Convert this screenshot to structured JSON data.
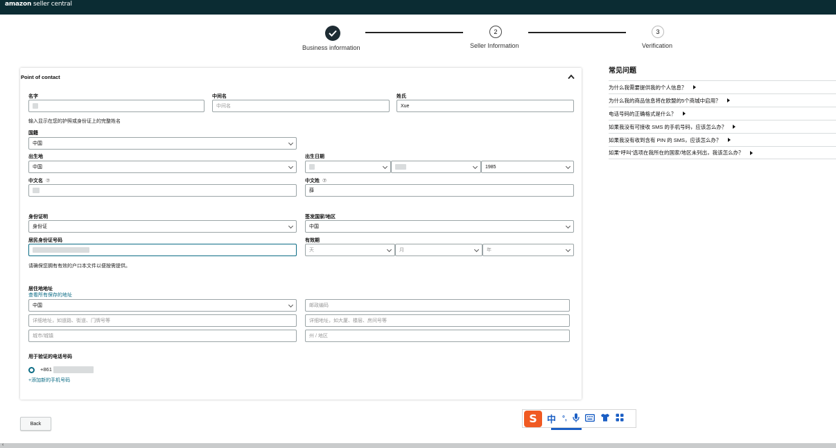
{
  "header": {
    "brand_strong": "amazon",
    "brand_rest": " seller central"
  },
  "stepper": {
    "steps": [
      {
        "label": "Business information",
        "num": "",
        "state": "done"
      },
      {
        "label": "Seller Information",
        "num": "2",
        "state": "current"
      },
      {
        "label": "Verification",
        "num": "3",
        "state": "upcoming"
      }
    ]
  },
  "form": {
    "section_title": "Point of contact",
    "first_name_label": "名字",
    "first_name_value": "",
    "middle_name_label": "中间名",
    "middle_name_placeholder": "中间名",
    "last_name_label": "姓氏",
    "last_name_value": "Xue",
    "name_hint": "输入显示在您的护照或身份证上的完整姓名",
    "nationality_label": "国籍",
    "nationality_value": "中国",
    "birthplace_label": "出生地",
    "birthplace_value": "中国",
    "dob_label": "出生日期",
    "dob_day": "",
    "dob_month": "",
    "dob_year": "1985",
    "cn_first_label": "中文名",
    "cn_first_help": "⑦",
    "cn_first_value": "",
    "cn_last_label": "中文姓",
    "cn_last_help": "⑦",
    "cn_last_value": "薛",
    "id_type_label": "身份证明",
    "id_type_value": "身份证",
    "issuing_country_label": "签发国家/地区",
    "issuing_country_value": "中国",
    "id_number_label": "居民身份证号码",
    "id_number_value": "",
    "expiry_label": "有效期",
    "expiry_day_ph": "天",
    "expiry_month_ph": "月",
    "expiry_year_ph": "年",
    "id_hint": "请确保您拥有有效的户口本文件以便按需提供。",
    "address_label": "居住地地址",
    "address_link": "查看所有保存的地址",
    "address_country": "中国",
    "postal_ph": "邮政编码",
    "street_ph": "详细地址，如道路、街道、门牌号等",
    "building_ph": "详细地址，如大厦、楼层、房间号等",
    "city_ph": "城市/城镇",
    "state_ph": "州 / 地区",
    "phone_label": "用于验证的电话号码",
    "phone_value": "+861",
    "add_phone_link": "+添加新的手机号码"
  },
  "back_label": "Back",
  "faq": {
    "title": "常见问题",
    "items": [
      "为什么我需要提供我的个人信息？",
      "为什么我的商品信息将在欧盟的5个商城中启用？",
      "电话号码的正确格式是什么？",
      "如果我没有可接收 SMS 的手机号码，应该怎么办？",
      "如果我没有收到含有 PIN 的 SMS，应该怎么办？",
      "如果“呼叫”选项在我所在的国家/地区未列出，我该怎么办？"
    ]
  },
  "ime": {
    "logo": "S",
    "mode": "中",
    "punct": "°,",
    "icons": [
      "mic-icon",
      "keyboard-icon",
      "skin-icon",
      "apps-icon"
    ]
  }
}
